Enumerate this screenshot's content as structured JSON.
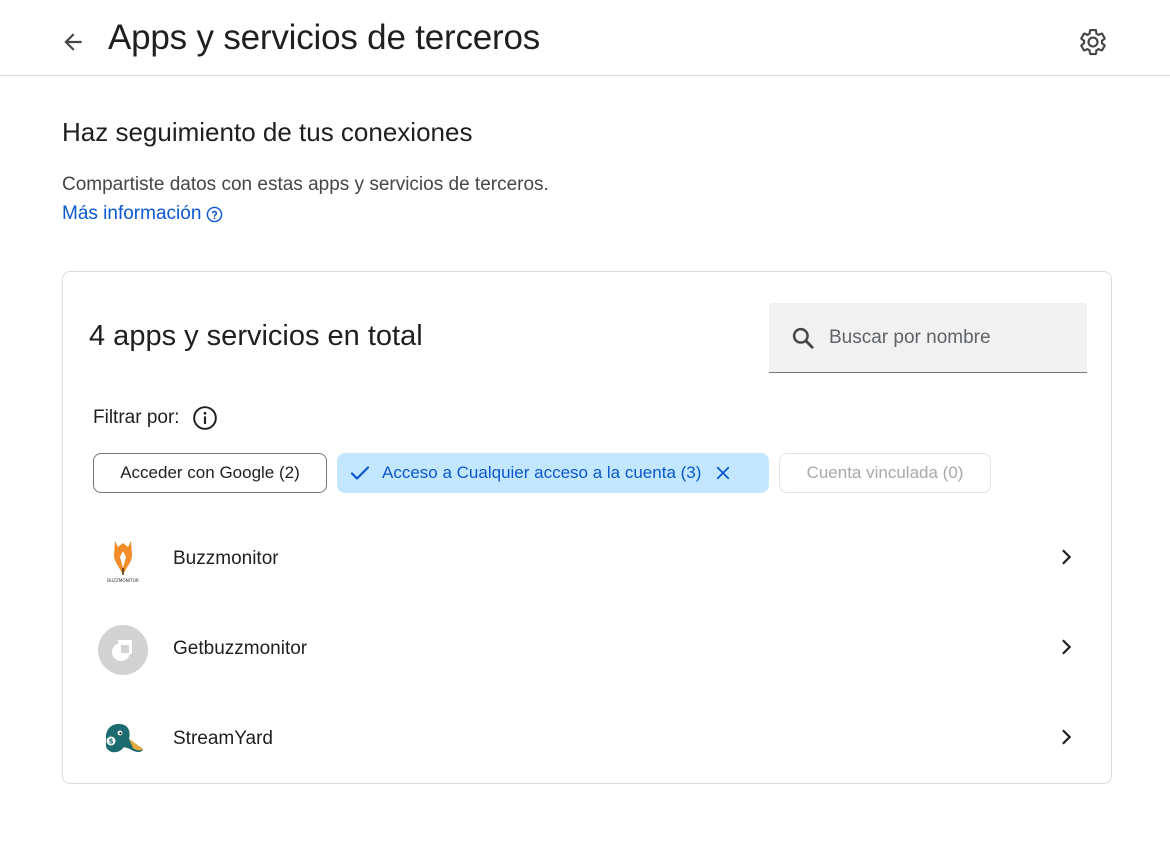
{
  "header": {
    "back_icon": "arrow-back-icon",
    "title": "Apps y servicios de terceros",
    "settings_icon": "gear-icon"
  },
  "intro": {
    "heading": "Haz seguimiento de tus conexiones",
    "description": "Compartiste datos con estas apps y servicios de terceros.",
    "more_info_link": "Más información",
    "more_info_icon": "help-circle-icon"
  },
  "card": {
    "title": "4 apps y servicios en total",
    "search": {
      "placeholder": "Buscar por nombre",
      "value": "",
      "icon": "search-icon"
    },
    "filter_label": "Filtrar por:",
    "filter_info_icon": "info-icon",
    "chips": [
      {
        "label": "Acceder con Google (2)",
        "state": "unselected"
      },
      {
        "label": "Acceso a Cualquier acceso a la cuenta (3)",
        "state": "selected"
      },
      {
        "label": "Cuenta vinculada (0)",
        "state": "disabled"
      }
    ],
    "apps": [
      {
        "name": "Buzzmonitor",
        "icon": "buzzmonitor-logo",
        "logo_text": "BUZZMONITOR"
      },
      {
        "name": "Getbuzzmonitor",
        "icon": "getbuzzmonitor-logo"
      },
      {
        "name": "StreamYard",
        "icon": "streamyard-logo"
      }
    ]
  },
  "colors": {
    "accent_blue": "#0b57d0",
    "selected_chip_bg": "#c2e7ff",
    "text_primary": "#1f1f1f",
    "border": "#dadce0",
    "search_bg": "#f1f1f1"
  }
}
